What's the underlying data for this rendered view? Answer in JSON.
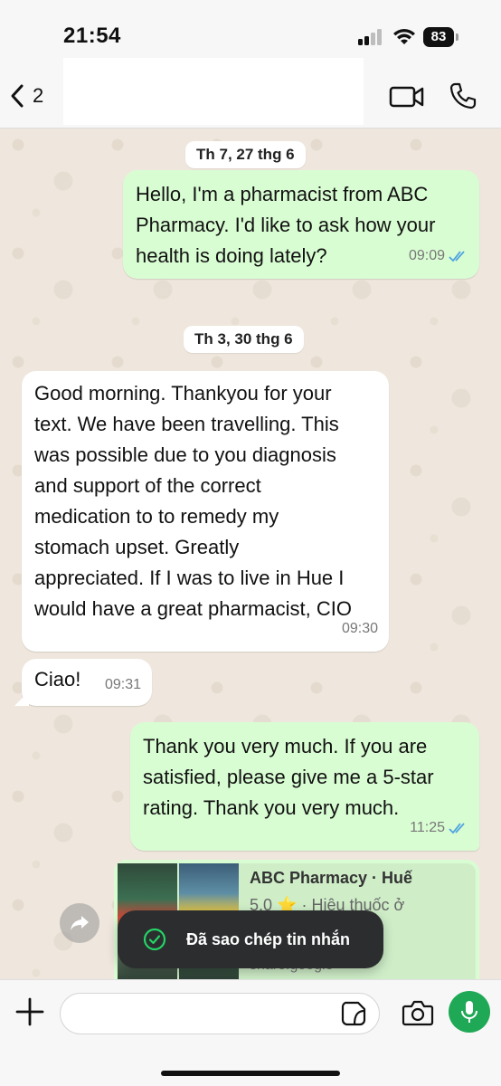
{
  "status_bar": {
    "time": "21:54",
    "battery": "83"
  },
  "header": {
    "back_count": "2"
  },
  "messages": [
    {
      "type": "date",
      "label": "Th 7, 27 thg 6"
    },
    {
      "type": "out",
      "text": "Hello, I'm a pharmacist from ABC\nPharmacy. I'd like to ask how your\nhealth is doing lately?",
      "time": "09:09"
    },
    {
      "type": "date",
      "label": "Th 3, 30 thg 6"
    },
    {
      "type": "in",
      "text": "Good morning. Thankyou for your\ntext. We have been travelling.  This\nwas possible due to you diagnosis\nand support of the correct\nmedication to to remedy my\nstomach upset.  Greatly\nappreciated. If I was to live in Hue I\nwould have a great pharmacist, CIO",
      "time": "09:30"
    },
    {
      "type": "in",
      "text": "Ciao!",
      "time": "09:31"
    },
    {
      "type": "out",
      "text": "Thank you very much. If you are\nsatisfied, please give me a 5-star\nrating. Thank you very much.",
      "time": "11:25"
    }
  ],
  "link_card": {
    "title": "ABC Pharmacy · Huế",
    "rating": "5.0",
    "star": "⭐",
    "category": "· Hiệu thuốc ở",
    "footer": "share.google"
  },
  "toast": {
    "text": "Đã sao chép tin nhắn"
  },
  "input": {
    "placeholder": ""
  },
  "colors": {
    "outgoing_bubble": "#d9fdd3",
    "incoming_bubble": "#ffffff",
    "read_ticks": "#4fa3e0",
    "mic_green": "#1fa855"
  }
}
